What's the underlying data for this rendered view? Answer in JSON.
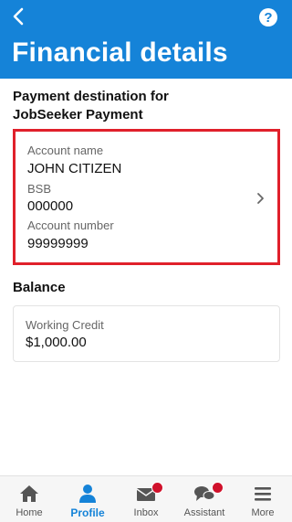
{
  "header": {
    "title": "Financial details",
    "back_icon": "chevron-left-icon",
    "help_icon": "question-mark-icon",
    "help_glyph": "?",
    "background": "#1583d8"
  },
  "payment_destination": {
    "heading": "Payment destination for JobSeeker Payment",
    "highlight_color": "#e0202b",
    "fields": {
      "account_name_label": "Account name",
      "account_name_value": "JOHN CITIZEN",
      "bsb_label": "BSB",
      "bsb_value": "000000",
      "account_number_label": "Account number",
      "account_number_value": "99999999"
    }
  },
  "balance": {
    "heading": "Balance",
    "label": "Working Credit",
    "value": "$1,000.00"
  },
  "tabbar": {
    "items": [
      {
        "label": "Home",
        "icon": "home-icon",
        "active": false
      },
      {
        "label": "Profile",
        "icon": "person-icon",
        "active": true
      },
      {
        "label": "Inbox",
        "icon": "mail-icon",
        "active": false,
        "badge": true
      },
      {
        "label": "Assistant",
        "icon": "chat-icon",
        "active": false,
        "badge": true
      },
      {
        "label": "More",
        "icon": "hamburger-icon",
        "active": false
      }
    ],
    "active_color": "#1583d8",
    "badge_color": "#d0112b"
  }
}
